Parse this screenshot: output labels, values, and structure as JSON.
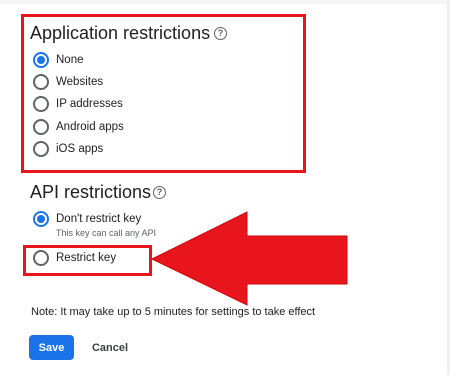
{
  "application_restrictions": {
    "title": "Application restrictions",
    "help_icon": "help-circle-icon",
    "options": [
      {
        "label": "None",
        "checked": true
      },
      {
        "label": "Websites",
        "checked": false
      },
      {
        "label": "IP addresses",
        "checked": false
      },
      {
        "label": "Android apps",
        "checked": false
      },
      {
        "label": "iOS apps",
        "checked": false
      }
    ]
  },
  "api_restrictions": {
    "title": "API restrictions",
    "help_icon": "help-circle-icon",
    "options": [
      {
        "label": "Don't restrict key",
        "sublabel": "This key can call any API",
        "checked": true
      },
      {
        "label": "Restrict key",
        "checked": false
      }
    ]
  },
  "note": "Note: It may take up to 5 minutes for settings to take effect",
  "buttons": {
    "save": "Save",
    "cancel": "Cancel"
  },
  "colors": {
    "accent": "#1a73e8",
    "highlight": "#e8161c"
  },
  "icons": {
    "help": "?"
  }
}
